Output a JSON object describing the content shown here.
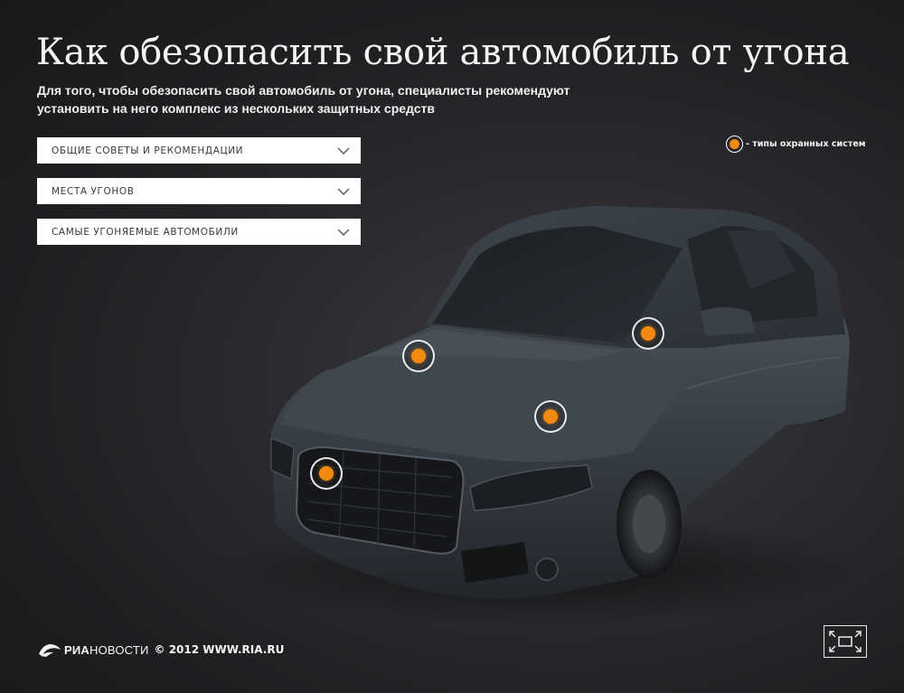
{
  "header": {
    "title": "Как обезопасить свой автомобиль от угона",
    "subtitle": "Для того, чтобы обезопасить свой автомобиль от угона, специалисты рекомендуют установить на него комплекс из нескольких защитных средств"
  },
  "dropdowns": [
    {
      "label": "ОБЩИЕ СОВЕТЫ И РЕКОМЕНДАЦИИ",
      "icon": "chevron-down-icon"
    },
    {
      "label": "МЕСТА УГОНОВ",
      "icon": "chevron-down-icon"
    },
    {
      "label": "САМЫЕ УГОНЯЕМЫЕ АВТОМОБИЛИ",
      "icon": "chevron-down-icon"
    }
  ],
  "legend": {
    "text": "- типы охранных систем",
    "icon": "orange-dot-icon",
    "color": "#f08a16"
  },
  "hotspots": [
    {
      "name": "hood",
      "icon": "orange-dot-icon"
    },
    {
      "name": "windshield",
      "icon": "orange-dot-icon"
    },
    {
      "name": "engine",
      "icon": "orange-dot-icon"
    },
    {
      "name": "grille",
      "icon": "orange-dot-icon"
    }
  ],
  "footer": {
    "brand_ria": "РИА",
    "brand_novosti": "НОВОСТИ",
    "copyright": "© 2012 WWW.RIA.RU",
    "logo_icon": "ria-novosti-logo"
  },
  "controls": {
    "fullscreen_icon": "fullscreen-icon"
  },
  "colors": {
    "background": "#26262a",
    "accent": "#f28a12",
    "car_body": "#3a4148"
  }
}
